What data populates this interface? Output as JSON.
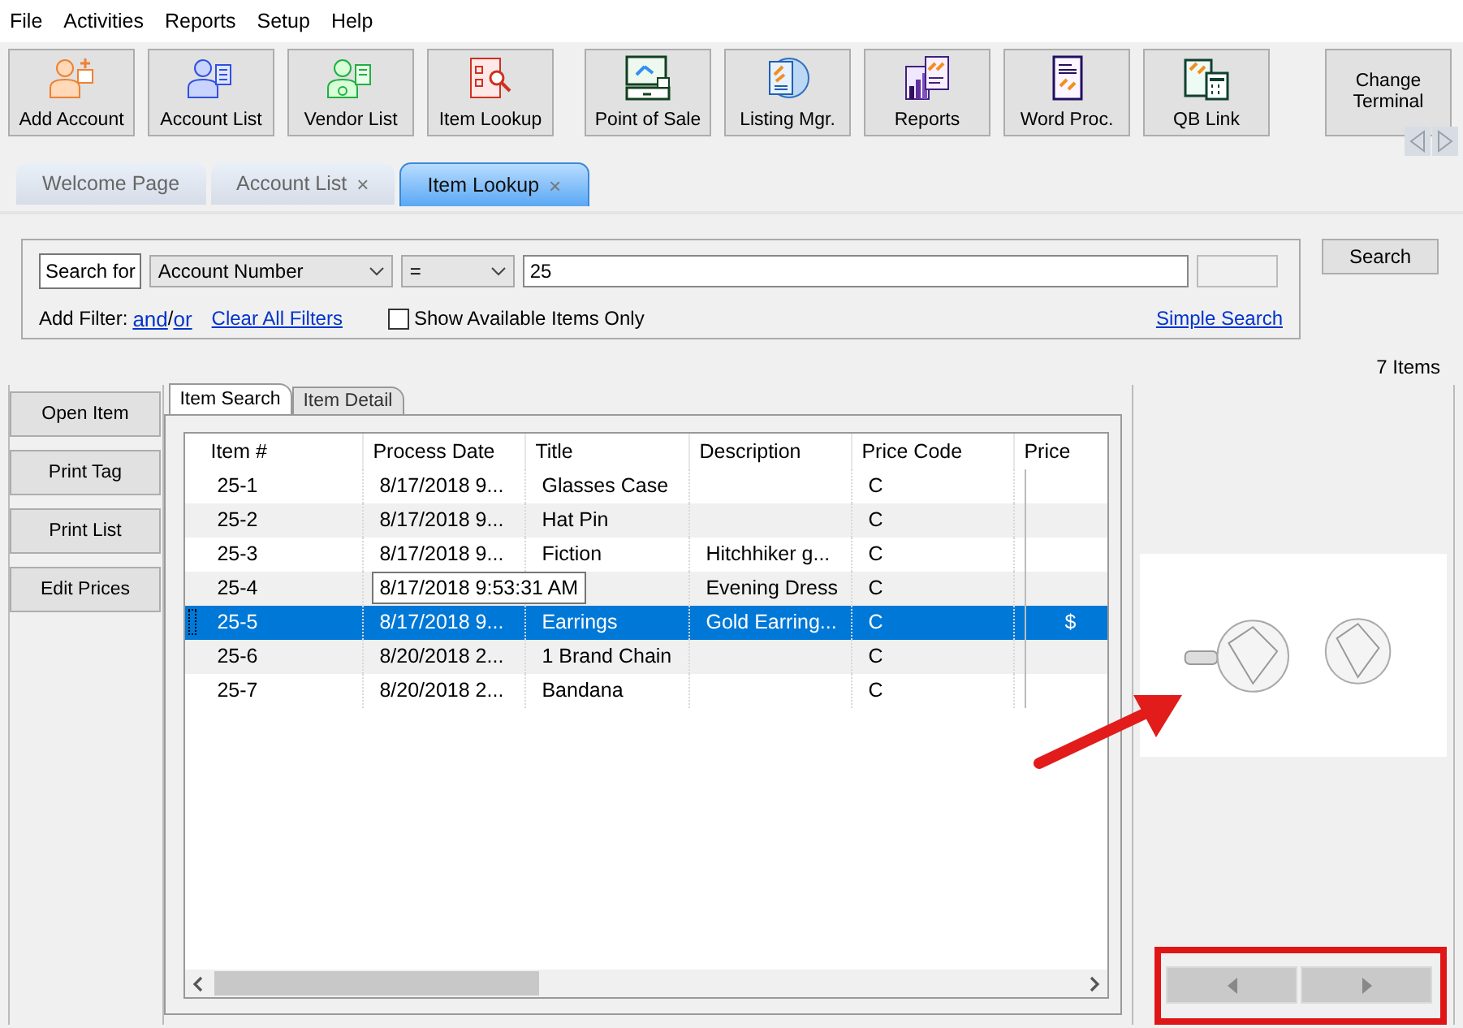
{
  "menu": [
    "File",
    "Activities",
    "Reports",
    "Setup",
    "Help"
  ],
  "toolbar": [
    {
      "label": "Add Account",
      "kind": "add-person"
    },
    {
      "label": "Account List",
      "kind": "person-list"
    },
    {
      "label": "Vendor List",
      "kind": "vendor"
    },
    {
      "label": "Item Lookup",
      "kind": "lookup"
    },
    {
      "label": "Point of Sale",
      "kind": "register"
    },
    {
      "label": "Listing Mgr.",
      "kind": "globe"
    },
    {
      "label": "Reports",
      "kind": "chart"
    },
    {
      "label": "Word Proc.",
      "kind": "document"
    },
    {
      "label": "QB Link",
      "kind": "calculator"
    }
  ],
  "change_terminal": "Change Terminal",
  "tabs": [
    {
      "label": "Welcome Page",
      "closable": false,
      "selected": false
    },
    {
      "label": "Account List",
      "closable": true,
      "selected": false
    },
    {
      "label": "Item Lookup",
      "closable": true,
      "selected": true
    }
  ],
  "close_glyph": "×",
  "search": {
    "label": "Search for",
    "field": "Account Number",
    "operator": "=",
    "value": "25",
    "add_filter": "Add Filter:",
    "and": "and",
    "separator": "/",
    "or": "or",
    "clear": "Clear All Filters",
    "available_only": {
      "label": "Show Available Items Only",
      "checked": false
    },
    "simple_search": "Simple Search"
  },
  "search_button": "Search",
  "item_count": "7 Items",
  "side_buttons": [
    "Open Item",
    "Print Tag",
    "Print List",
    "Edit Prices"
  ],
  "subtabs": [
    {
      "label": "Item Search",
      "selected": true
    },
    {
      "label": "Item Detail",
      "selected": false
    }
  ],
  "table": {
    "columns": [
      "Item #",
      "Process Date",
      "Title",
      "Description",
      "Price Code",
      "Price"
    ],
    "rows": [
      {
        "cells": [
          "25-1",
          "8/17/2018 9...",
          "Glasses Case",
          null,
          "C",
          null
        ],
        "selected": false
      },
      {
        "cells": [
          "25-2",
          "8/17/2018 9...",
          "Hat Pin",
          null,
          "C",
          null
        ],
        "selected": false
      },
      {
        "cells": [
          "25-3",
          "8/17/2018 9...",
          "Fiction",
          "Hitchhiker g...",
          "C",
          null
        ],
        "selected": false
      },
      {
        "cells": [
          "25-4",
          null,
          null,
          "Evening Dress",
          "C",
          null
        ],
        "selected": false
      },
      {
        "cells": [
          "25-5",
          "8/17/2018 9...",
          "Earrings",
          "Gold Earring...",
          "C",
          "$"
        ],
        "selected": true
      },
      {
        "cells": [
          "25-6",
          "8/20/2018 2...",
          "1 Brand Chain",
          null,
          "C",
          null
        ],
        "selected": false
      },
      {
        "cells": [
          "25-7",
          "8/20/2018 2...",
          "Bandana",
          null,
          "C",
          null
        ],
        "selected": false
      }
    ],
    "tooltip": "8/17/2018 9:53:31 AM"
  }
}
